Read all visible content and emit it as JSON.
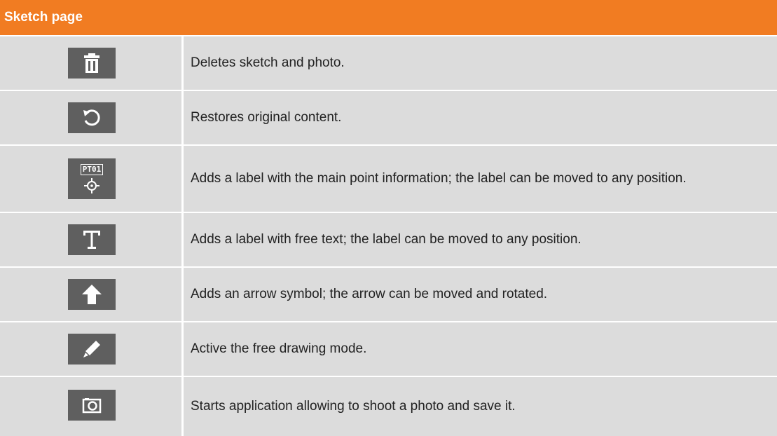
{
  "table": {
    "header": "Sketch page",
    "colors": {
      "header_bg": "#f17c22",
      "header_text": "#ffffff",
      "cell_bg": "#dcdcdc",
      "icon_bg": "#5f5f5f",
      "text": "#222222"
    },
    "rows": [
      {
        "icon": "trash-icon",
        "description": "Deletes sketch and photo."
      },
      {
        "icon": "restore-icon",
        "description": "Restores original content."
      },
      {
        "icon": "point-label-icon",
        "icon_text": "PT01",
        "description": "Adds a label with the main point information; the label can be moved to any position."
      },
      {
        "icon": "text-label-icon",
        "description": "Adds a label with free text; the label can be moved to any position."
      },
      {
        "icon": "arrow-up-icon",
        "description": "Adds an arrow symbol; the arrow can be moved and rotated."
      },
      {
        "icon": "pencil-icon",
        "description": "Active the free drawing mode."
      },
      {
        "icon": "camera-icon",
        "description": "Starts application allowing to shoot a photo and save it."
      }
    ]
  }
}
